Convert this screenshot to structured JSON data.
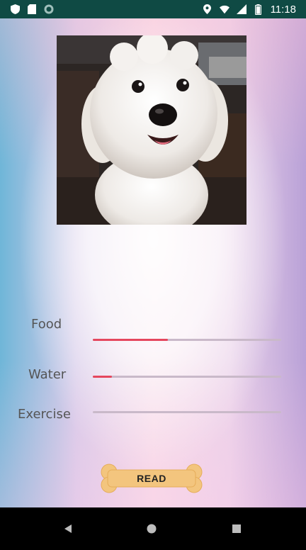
{
  "status_bar": {
    "time": "11:18",
    "left_icons": [
      "shield-icon",
      "sd-card-icon",
      "circle-icon"
    ],
    "right_icons": [
      "location-icon",
      "wifi-icon",
      "signal-icon",
      "battery-icon"
    ]
  },
  "photo": {
    "subject": "white fluffy dog photo"
  },
  "stats": [
    {
      "label": "Food",
      "level": 0.4
    },
    {
      "label": "Water",
      "level": 0.1
    },
    {
      "label": "Exercise",
      "level": 0.0
    }
  ],
  "read_button": {
    "label": "READ"
  },
  "colors": {
    "status_bar": "#0f4a44",
    "progress_fill": "#e5475e",
    "progress_track": "#c9b9c9",
    "bone": "#f3c57e"
  },
  "nav_bar": {
    "buttons": [
      "back-icon",
      "home-icon",
      "recents-icon"
    ]
  }
}
